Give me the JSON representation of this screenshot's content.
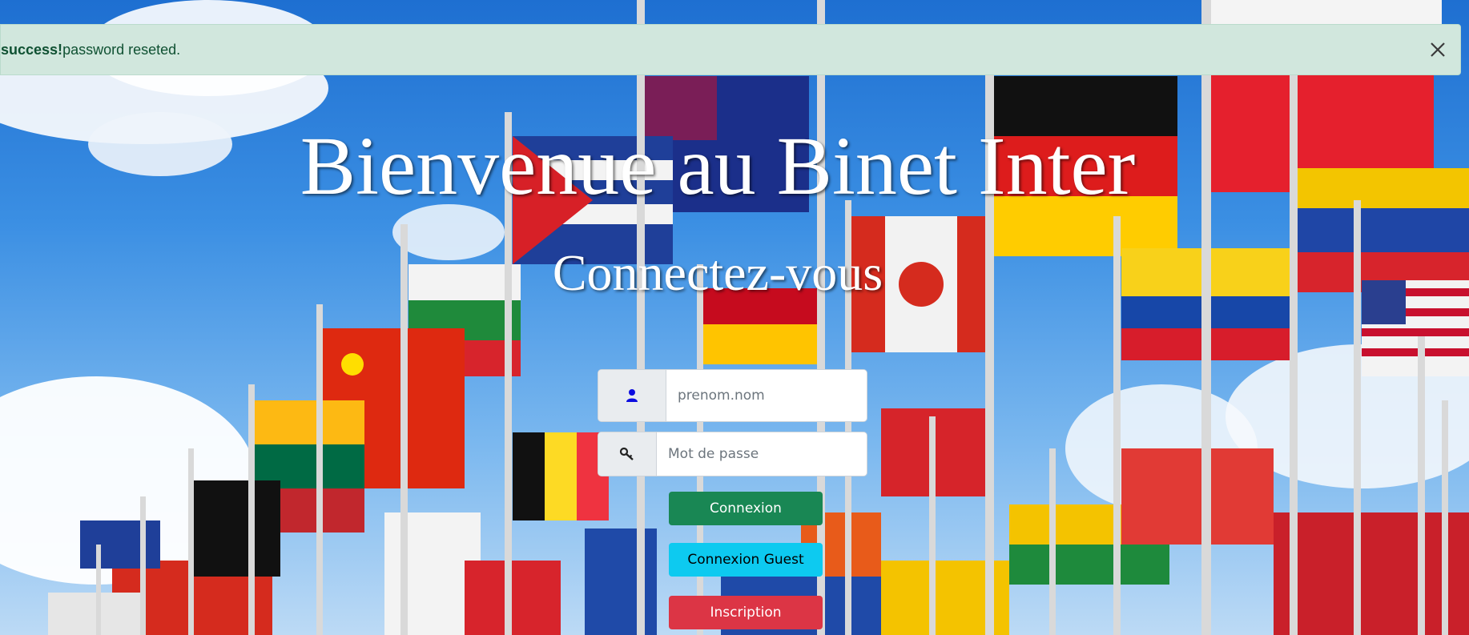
{
  "alert": {
    "strong": "success!",
    "message": "password reseted.",
    "close_icon": "close-icon"
  },
  "titles": {
    "main": "Bienvenue au Binet Inter",
    "sub": "Connectez-vous"
  },
  "form": {
    "username": {
      "icon": "user-icon",
      "placeholder": "prenom.nom",
      "value": ""
    },
    "password": {
      "icon": "key-icon",
      "placeholder": "Mot de passe",
      "value": ""
    },
    "buttons": {
      "login": "Connexion",
      "guest": "Connexion Guest",
      "signup": "Inscription"
    }
  },
  "colors": {
    "success": "#198754",
    "info": "#0dcaf0",
    "danger": "#dc3545",
    "alert_bg": "#d1e7dd",
    "user_icon": "#0d0de0"
  }
}
